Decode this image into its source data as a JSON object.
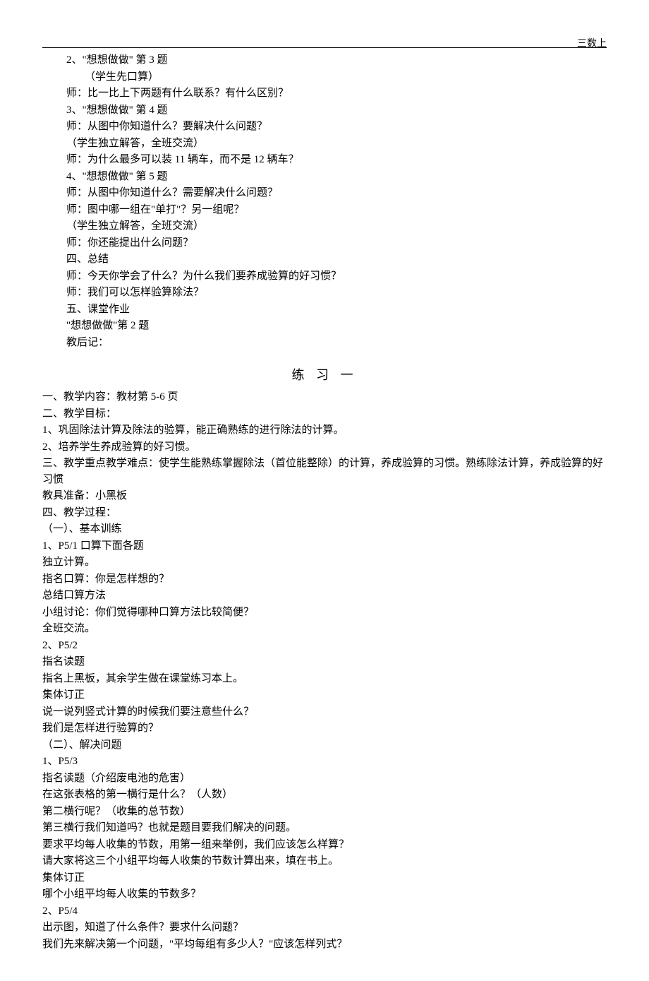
{
  "header": {
    "right": "三数上"
  },
  "block1": {
    "l01": "2、\"想想做做\" 第 3 题",
    "l02": "（学生先口算）",
    "l03": "师：比一比上下两题有什么联系？有什么区别？",
    "l04": "3、\"想想做做\" 第 4 题",
    "l05": "师：从图中你知道什么？要解决什么问题？",
    "l06": "（学生独立解答，全班交流）",
    "l07": "师：为什么最多可以装 11 辆车，而不是 12 辆车？",
    "l08": "4、\"想想做做\" 第 5 题",
    "l09": "师：从图中你知道什么？需要解决什么问题？",
    "l10": "师：图中哪一组在\"单打\"？另一组呢？",
    "l11": "（学生独立解答，全班交流）",
    "l12": "师：你还能提出什么问题？",
    "l13": "四、总结",
    "l14": "师：今天你学会了什么？为什么我们要养成验算的好习惯？",
    "l15": "师：我们可以怎样验算除法？",
    "l16": "五、课堂作业",
    "l17": "\"想想做做\"第 2 题",
    "l18": "教后记："
  },
  "section_title": "练 习 一",
  "block2": {
    "l01": "一、教学内容：教材第 5-6 页",
    "l02": "二、教学目标：",
    "l03": "1、巩固除法计算及除法的验算，能正确熟练的进行除法的计算。",
    "l04": "2、培养学生养成验算的好习惯。",
    "l05": "三、教学重点教学难点：使学生能熟练掌握除法（首位能整除）的计算，养成验算的习惯。熟练除法计算，养成验算的好习惯",
    "l06": "教具准备：小黑板",
    "l07": "四、教学过程：",
    "l08": "（一）、基本训练",
    "l09": "1、P5/1 口算下面各题",
    "l10": "独立计算。",
    "l11": "指名口算：你是怎样想的？",
    "l12": "总结口算方法",
    "l13": "小组讨论：你们觉得哪种口算方法比较简便？",
    "l14": "全班交流。",
    "l15": "2、P5/2",
    "l16": "指名读题",
    "l17": "指名上黑板，其余学生做在课堂练习本上。",
    "l18": "集体订正",
    "l19": "说一说列竖式计算的时候我们要注意些什么？",
    "l20": "我们是怎样进行验算的？",
    "l21": "（二）、解决问题",
    "l22": "1、P5/3",
    "l23": "指名读题（介绍废电池的危害）",
    "l24": "在这张表格的第一横行是什么？（人数）",
    "l25": "第二横行呢？（收集的总节数）",
    "l26": "第三横行我们知道吗？也就是题目要我们解决的问题。",
    "l27": "要求平均每人收集的节数，用第一组来举例，我们应该怎么样算？",
    "l28": "请大家将这三个小组平均每人收集的节数计算出来，填在书上。",
    "l29": "集体订正",
    "l30": "哪个小组平均每人收集的节数多？",
    "l31": "2、P5/4",
    "l32": "出示图，知道了什么条件？要求什么问题？",
    "l33": "我们先来解决第一个问题，\"平均每组有多少人？\"应该怎样列式？"
  }
}
